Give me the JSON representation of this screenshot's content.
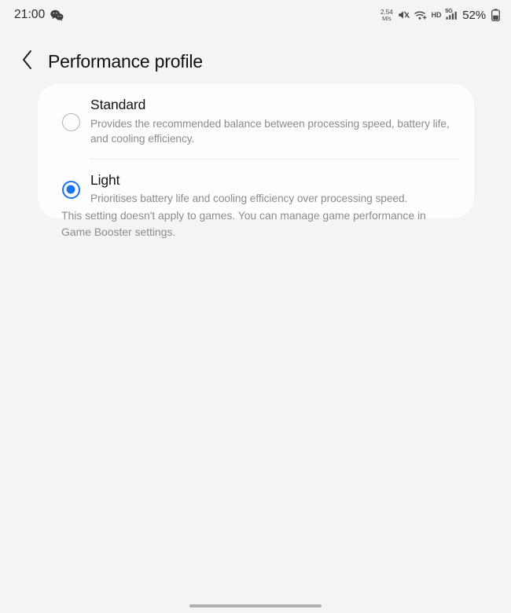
{
  "status_bar": {
    "time": "21:00",
    "notification_icon": "wechat-icon",
    "network_speed_value": "2.54",
    "network_speed_unit": "M/s",
    "mute_icon": "sound-muted-icon",
    "wifi_icon": "wifi-icon",
    "hd_label": "HD",
    "network_type": "5G",
    "signal_icon": "cellular-signal-icon",
    "battery_percent": "52%",
    "battery_icon": "battery-icon"
  },
  "header": {
    "back_icon": "chevron-left-icon",
    "title": "Performance profile"
  },
  "options": [
    {
      "id": "standard",
      "title": "Standard",
      "description": "Provides the recommended balance between processing speed, battery life, and cooling efficiency.",
      "selected": false
    },
    {
      "id": "light",
      "title": "Light",
      "description": "Prioritises battery life and cooling efficiency over processing speed.",
      "selected": true
    }
  ],
  "footer_note": "This setting doesn't apply to games. You can manage game performance in Game Booster settings.",
  "navigation": {
    "gesture_handle": "home-gesture-handle"
  },
  "colors": {
    "accent": "#1a73e8",
    "page_background": "#f4f4f4",
    "card_background": "#fdfdfd",
    "primary_text": "#141414",
    "secondary_text": "#8c8c8c"
  }
}
